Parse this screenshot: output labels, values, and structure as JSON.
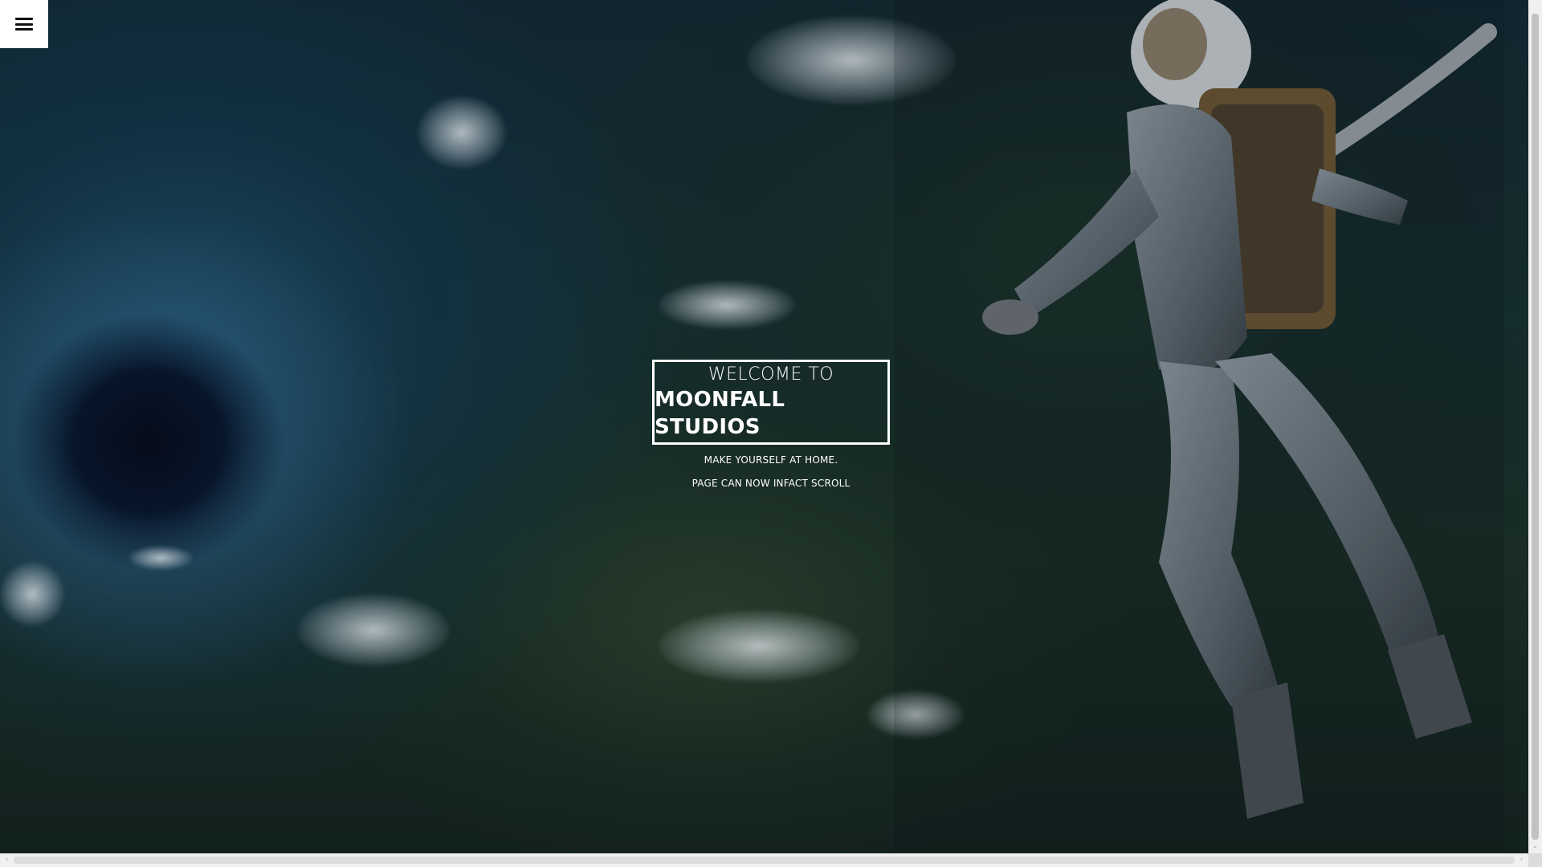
{
  "menu": {
    "icon": "hamburger-menu-icon"
  },
  "hero": {
    "welcome": "WELCOME TO",
    "studio_name": "MOONFALL STUDIOS",
    "tagline": "MAKE YOURSELF AT HOME.",
    "subtagline": "PAGE CAN NOW INFACT SCROLL"
  },
  "scrollbar": {
    "left_arrow": "‹",
    "right_arrow": "›",
    "down_arrow": "⌄"
  },
  "colors": {
    "frame": "#ffffff",
    "text": "#ffffff",
    "scrollbar_track": "#f0f0f0"
  }
}
